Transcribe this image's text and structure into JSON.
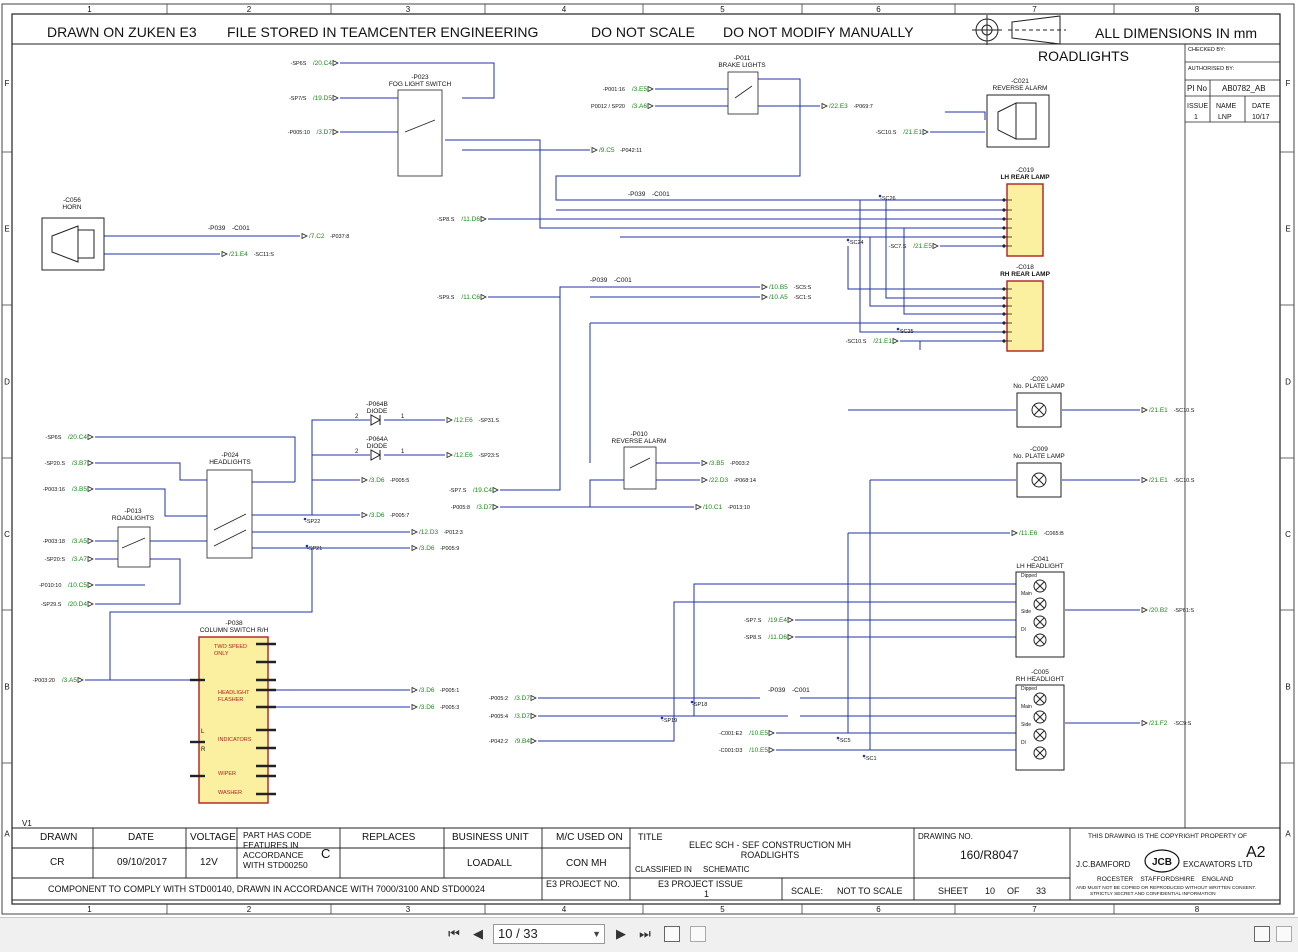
{
  "header": {
    "drawn_on": "DRAWN ON ZUKEN E3",
    "file_stored": "FILE STORED IN TEAMCENTER ENGINEERING",
    "do_not_scale": "DO NOT SCALE",
    "do_not_modify": "DO NOT MODIFY MANUALLY",
    "dimensions": "ALL DIMENSIONS IN mm",
    "sheet_title": "ROADLIGHTS"
  },
  "border": {
    "columns": [
      "1",
      "2",
      "3",
      "4",
      "5",
      "6",
      "7",
      "8"
    ],
    "rows": [
      "F",
      "E",
      "D",
      "C",
      "B",
      "A"
    ]
  },
  "approval": {
    "checked_by": "CHECKED BY:",
    "authorised_by": "AUTHORISED BY:",
    "pi_no_label": "PI No",
    "pi_no": "AB0782_AB",
    "issue_label": "ISSUE",
    "name_label": "NAME",
    "date_label": "DATE",
    "issue": "1",
    "name": "LNP",
    "date": "10/17"
  },
  "title_block": {
    "drawn_label": "DRAWN",
    "drawn": "CR",
    "date_label": "DATE",
    "date": "09/10/2017",
    "voltage_label": "VOLTAGE",
    "voltage": "12V",
    "part_code": "PART HAS CODE FEATURES IN ACCORDANCE WITH STD00250",
    "part_code_class": "C",
    "replaces_label": "REPLACES",
    "business_unit_label": "BUSINESS UNIT",
    "business_unit": "LOADALL",
    "mc_used_label": "M/C USED ON",
    "mc_used": "CON MH",
    "title_label": "TITLE",
    "title_line1": "ELEC SCH - SEF CONSTRUCTION MH",
    "title_line2": "ROADLIGHTS",
    "classified_label": "CLASSIFIED IN",
    "classified": "SCHEMATIC",
    "drawing_no_label": "DRAWING NO.",
    "drawing_no": "160/R8047",
    "copyright": "THIS DRAWING IS THE COPYRIGHT PROPERTY OF",
    "size": "A2",
    "company_left": "J.C.BAMFORD",
    "company_right": "EXCAVATORS LTD",
    "logo_text": "JCB",
    "address": "ROCESTER    STAFFORDSHIRE    ENGLAND",
    "notice1": "AND MUST NOT BE COPIED OR REPRODUCED WITHOUT WRITTEN CONSENT.",
    "notice2": "STRICTLY SECRET AND CONFIDENTIAL INFORMATION",
    "comply_note": "COMPONENT TO COMPLY WITH STD00140, DRAWN IN ACCORDANCE WITH 7000/3100 AND STD00024",
    "e3_project_no_label": "E3 PROJECT NO.",
    "e3_issue_label": "E3 PROJECT ISSUE",
    "e3_issue": "1",
    "scale_label": "SCALE:",
    "scale": "NOT TO SCALE",
    "sheet_label": "SHEET",
    "sheet": "10",
    "of_label": "OF",
    "of": "33",
    "version": "V1"
  },
  "components": [
    {
      "id": "-P023",
      "name": "FOG LIGHT SWITCH"
    },
    {
      "id": "-P011",
      "name": "BRAKE LIGHTS"
    },
    {
      "id": "-C021",
      "name": "REVERSE ALARM"
    },
    {
      "id": "-C056",
      "name": "HORN"
    },
    {
      "id": "-C019",
      "name": "LH REAR LAMP"
    },
    {
      "id": "-C018",
      "name": "RH REAR LAMP"
    },
    {
      "id": "-C020",
      "name": "No. PLATE LAMP"
    },
    {
      "id": "-C009",
      "name": "No. PLATE LAMP"
    },
    {
      "id": "-P064B",
      "name": "DIODE"
    },
    {
      "id": "-P064A",
      "name": "DIODE"
    },
    {
      "id": "-P024",
      "name": "HEADLIGHTS"
    },
    {
      "id": "-P013",
      "name": "ROADLIGHTS"
    },
    {
      "id": "-P010",
      "name": "REVERSE ALARM"
    },
    {
      "id": "-C041",
      "name": "LH HEADLIGHT"
    },
    {
      "id": "-C005",
      "name": "RH HEADLIGHT"
    },
    {
      "id": "-P038",
      "name": "COLUMN SWITCH R/H"
    }
  ],
  "connectors": [
    "-P039",
    "-C001"
  ],
  "column_switch": {
    "sections": [
      "TWO SPEED ONLY",
      "HEADLIGHT FLASHER",
      "INDICATORS",
      "WIPER",
      "WASHER"
    ],
    "lr": [
      "L",
      "R"
    ]
  },
  "headlight_lamps": [
    "Dipped",
    "Main",
    "Side",
    "Dl"
  ],
  "cross_refs": [
    {
      "sig": "-SP6S",
      "ref": "/20.C4"
    },
    {
      "sig": "-SP7/S",
      "ref": "/19.D5"
    },
    {
      "sig": "-P005:10",
      "ref": "/3.D7"
    },
    {
      "sig": "-P042:11",
      "ref": "/9.C5"
    },
    {
      "sig": "-P001:16",
      "ref": "/3.E5"
    },
    {
      "sig": "P0012 / SP20",
      "ref": "/3.A6"
    },
    {
      "sig": "-P069:7",
      "ref": "/22.E3"
    },
    {
      "sig": "-SC10.S",
      "ref": "/21.E1"
    },
    {
      "sig": "-SP8.S",
      "ref": "/11.D6"
    },
    {
      "sig": "-P037:8",
      "ref": "/7.C2"
    },
    {
      "sig": "-SC11:S",
      "ref": "/21.E4"
    },
    {
      "sig": "-SC7.S",
      "ref": "/21.E5"
    },
    {
      "sig": "-SP9.S",
      "ref": "/11.C6"
    },
    {
      "sig": "-SC5:S",
      "ref": "/10.B5"
    },
    {
      "sig": "-SC1:S",
      "ref": "/10.A5"
    },
    {
      "sig": "-SC10.S",
      "ref": "/21.E1"
    },
    {
      "sig": "-SP6S",
      "ref": "/20.C4"
    },
    {
      "sig": "-SP20.S",
      "ref": "/3.B7"
    },
    {
      "sig": "-P003:16",
      "ref": "/3.B5"
    },
    {
      "sig": "-SP31.S",
      "ref": "/12.E6"
    },
    {
      "sig": "-SP23:S",
      "ref": "/12.E6"
    },
    {
      "sig": "-P005:5",
      "ref": "/3.D6"
    },
    {
      "sig": "-P005:7",
      "ref": "/3.D6"
    },
    {
      "sig": "-P012:3",
      "ref": "/12.D3"
    },
    {
      "sig": "-P005:9",
      "ref": "/3.D6"
    },
    {
      "sig": "-P003:18",
      "ref": "/3.A5"
    },
    {
      "sig": "-SP20:S",
      "ref": "/3.A7"
    },
    {
      "sig": "-P010:10",
      "ref": "/10.C5"
    },
    {
      "sig": "-SP29.S",
      "ref": "/20.D4"
    },
    {
      "sig": "-SP7.S",
      "ref": "/19.C4"
    },
    {
      "sig": "-P005:8",
      "ref": "/3.D7"
    },
    {
      "sig": "-P003:2",
      "ref": "/3.B5"
    },
    {
      "sig": "-P068:14",
      "ref": "/22.D3"
    },
    {
      "sig": "-P013:10",
      "ref": "/10.C1"
    },
    {
      "sig": "-SC10.S",
      "ref": "/21.E1"
    },
    {
      "sig": "-SC10.S",
      "ref": "/21.E1"
    },
    {
      "sig": "-C065:B",
      "ref": "/11.E6"
    },
    {
      "sig": "-SP7.S",
      "ref": "/19.E4"
    },
    {
      "sig": "-SP8.S",
      "ref": "/11.D6"
    },
    {
      "sig": "-SP61:S",
      "ref": "/20.B2"
    },
    {
      "sig": "-SC9:S",
      "ref": "/21.F2"
    },
    {
      "sig": "-P003:20",
      "ref": "/3.A5"
    },
    {
      "sig": "-P005:1",
      "ref": "/3.D6"
    },
    {
      "sig": "-P005:3",
      "ref": "/3.D6"
    },
    {
      "sig": "-P005:2",
      "ref": "/3.D7"
    },
    {
      "sig": "-P005:4",
      "ref": "/3.D7"
    },
    {
      "sig": "-P042:2",
      "ref": "/9.B4"
    },
    {
      "sig": "-C001:E2",
      "ref": "/10.E5"
    },
    {
      "sig": "-C001:D3",
      "ref": "/10.E5"
    }
  ],
  "nodes": [
    "-SC26",
    "-SC24",
    "-SC25",
    "-SP22",
    "-SP21",
    "-SP18",
    "-SP19",
    "-SC5",
    "-SC1"
  ],
  "viewer": {
    "page_indicator": "10 / 33"
  }
}
